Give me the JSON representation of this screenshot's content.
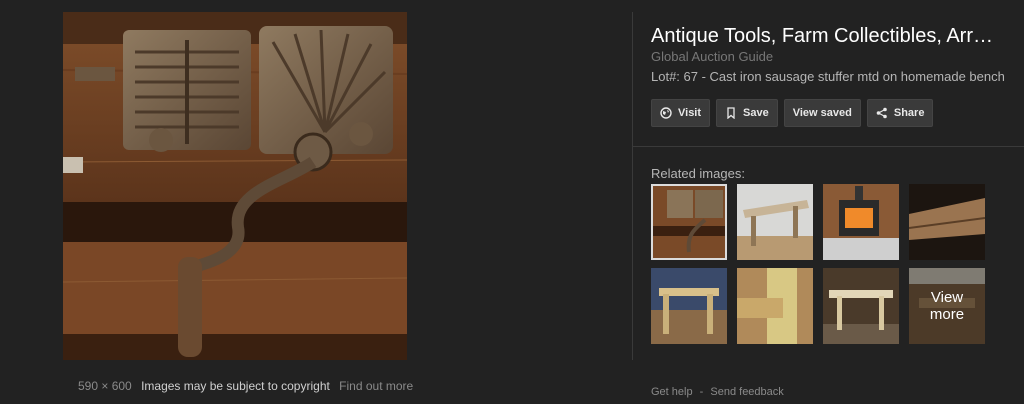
{
  "main_image": {
    "dimensions": "590 × 600",
    "copyright_note": "Images may be subject to copyright",
    "find_out_more": "Find out more"
  },
  "details": {
    "title": "Antique Tools, Farm Collectibles, Arr…",
    "source": "Global Auction Guide",
    "description": "Lot#: 67 - Cast iron sausage stuffer mtd on homemade bench"
  },
  "actions": {
    "visit": "Visit",
    "save": "Save",
    "view_saved": "View saved",
    "share": "Share"
  },
  "related": {
    "label": "Related images:",
    "view_more": "View\nmore",
    "thumbnails": [
      "sausage-stuffer",
      "wooden-bench",
      "wood-stove",
      "planks",
      "bench-frame",
      "timber-joint",
      "workbench",
      "sawyers-bench"
    ]
  },
  "footer": {
    "help": "Get help",
    "sep": "-",
    "feedback": "Send feedback"
  }
}
